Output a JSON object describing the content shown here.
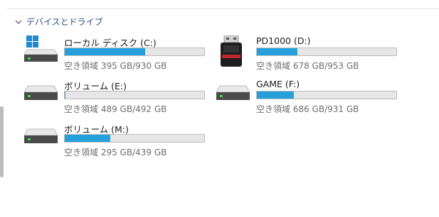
{
  "section": {
    "title": "デバイスとドライブ"
  },
  "drives": [
    {
      "name": "ローカル ディスク (C:)",
      "free_text": "空き領域 395 GB/930 GB",
      "used_fraction": 0.575,
      "icon": "windows-drive-icon"
    },
    {
      "name": "PD1000 (D:)",
      "free_text": "空き領域 678 GB/953 GB",
      "used_fraction": 0.289,
      "icon": "usb-drive-icon"
    },
    {
      "name": "ボリューム (E:)",
      "free_text": "空き領域 489 GB/492 GB",
      "used_fraction": 0.006,
      "icon": "hard-drive-icon"
    },
    {
      "name": "GAME (F:)",
      "free_text": "空き領域 686 GB/931 GB",
      "used_fraction": 0.263,
      "icon": "hard-drive-icon"
    },
    {
      "name": "ボリューム (M:)",
      "free_text": "空き領域 295 GB/439 GB",
      "used_fraction": 0.328,
      "icon": "hard-drive-icon"
    }
  ],
  "colors": {
    "bar_fill": "#26a0da",
    "bar_bg": "#e6e6e6",
    "header_text": "#2b4d8a"
  }
}
